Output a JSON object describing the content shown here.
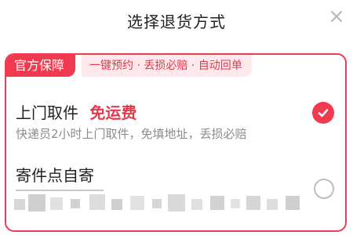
{
  "header": {
    "title": "选择退货方式"
  },
  "tags": {
    "official": "官方保障",
    "features": "一键预约 · 丢损必赔 · 自动回单"
  },
  "options": [
    {
      "title": "上门取件",
      "badge": "免运费",
      "desc": "快递员2小时上门取件，免填地址，丢损必赔",
      "selected": true
    },
    {
      "title": "寄件点自寄",
      "desc_visible": false,
      "selected": false
    }
  ],
  "colors": {
    "accent": "#f03a4f",
    "accent_light": "#fde9ec",
    "text": "#222222",
    "muted": "#8b8b8b"
  },
  "icons": {
    "close": "close-icon",
    "selected": "checkmark-icon"
  }
}
